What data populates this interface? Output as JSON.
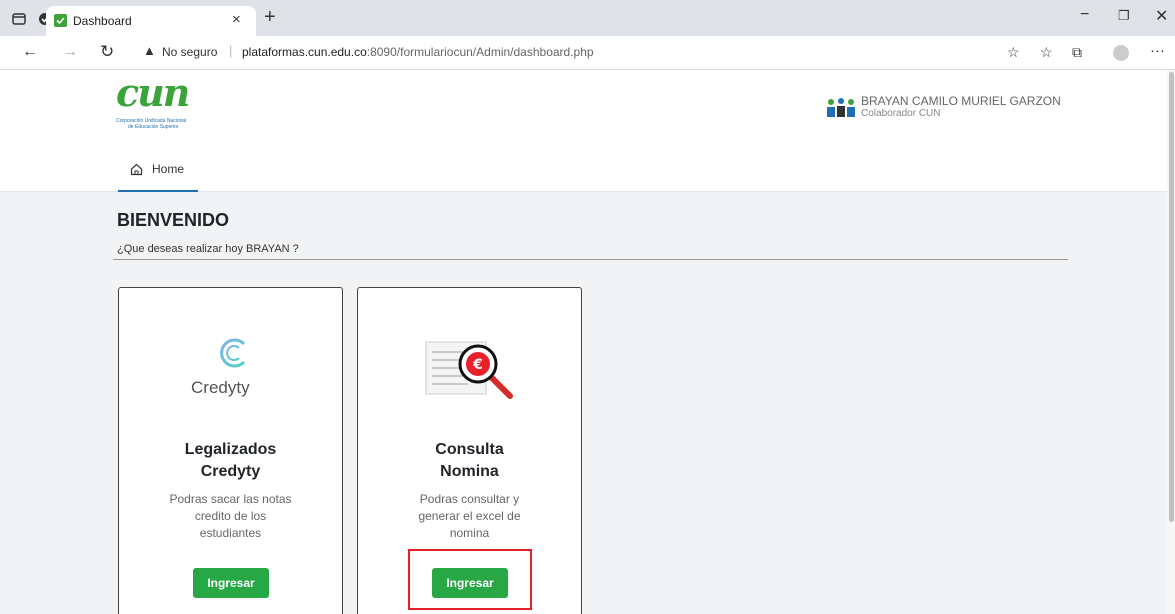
{
  "browser": {
    "tab_title": "Dashboard",
    "security_label": "No seguro",
    "url_host": "plataformas.cun.edu.co",
    "url_rest": ":8090/formulariocun/Admin/dashboard.php"
  },
  "header": {
    "logo_text": "cun",
    "logo_sub1": "Corporación Unificada Nacional",
    "logo_sub2": "de Educación Superior",
    "user_name": "BRAYAN CAMILO MURIEL GARZON",
    "user_role": "Colaborador CUN"
  },
  "nav": {
    "home_label": "Home"
  },
  "main": {
    "title": "BIENVENIDO",
    "subtitle": "¿Que deseas realizar hoy BRAYAN ?",
    "cards": [
      {
        "logo_text": "Credyty",
        "title_1": "Legalizados",
        "title_2": "Credyty",
        "text_1": "Podras sacar las notas",
        "text_2": "credito de los",
        "text_3": "estudiantes",
        "button": "Ingresar"
      },
      {
        "title_1": "Consulta",
        "title_2": "Nomina",
        "text_1": "Podras consultar y",
        "text_2": "generar el excel de",
        "text_3": "nomina",
        "button": "Ingresar"
      }
    ]
  },
  "colors": {
    "accent": "#28a745",
    "highlight": "#e8202a",
    "brand_green": "#3aa33a"
  }
}
